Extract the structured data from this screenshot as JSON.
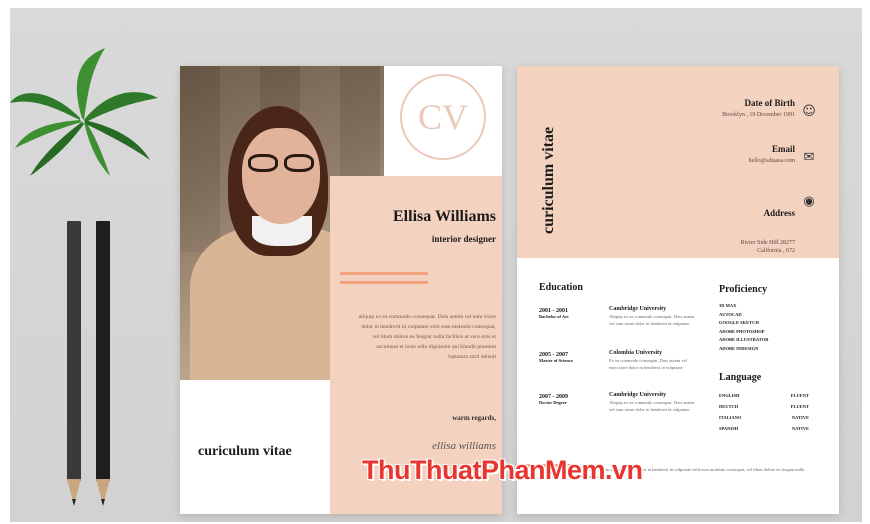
{
  "left_sheet": {
    "monogram": "CV",
    "name": "Ellisa Williams",
    "role": "interior designer",
    "intro": "aliquip ex ea commodo consequat. Duis autem vel eum iriure dolor in hendrerit in vulputate velit esse molestie consequat, vel illum dolore eu feugiat nulla facilisis at vero eros et accumsan et iusto odio dignissim qui blandit praesent luptatum zzril delenit",
    "regards": "warm regards,",
    "signature": "ellisa williams",
    "footer_title": "curiculum vitae"
  },
  "right_sheet": {
    "vertical_title": "curiculum vitae",
    "contact": [
      {
        "label": "Date of Birth",
        "value": "Brooklyn , 19 December 1991",
        "icon": "person-icon"
      },
      {
        "label": "Email",
        "value": "hello@sdiassa.com",
        "icon": "envelope-icon"
      },
      {
        "label": "Address",
        "value": "Rivier Side Hill 28277\nCalifornia , 672",
        "icon": "location-pin-icon"
      }
    ],
    "education_title": "Education",
    "education": [
      {
        "years": "2001 - 2001",
        "degree": "Bachelor of Art",
        "school": "Cambridge University",
        "text": "Aliquip ex ea commodo consequat. Duis autem vel eum iriure dolor in hendrerit in vulputate"
      },
      {
        "years": "2005 - 2007",
        "degree": "Master of Science",
        "school": "Colombia University",
        "text": "Ex ea commodo consequat. Duis autem vel eum iriure dolor in hendrerit in vulputate"
      },
      {
        "years": "2007 - 2009",
        "degree": "Doctor Degree",
        "school": "Cambridge University",
        "text": "Aliquip ex ea commodo consequat. Duis autem vel eum iriure dolor in hendrerit in vulputate"
      }
    ],
    "proficiency_title": "Proficiency",
    "skills": [
      "3D MAX",
      "AUTOCAD",
      "GOOGLE SKETCH",
      "ADOBE PHOTOSHOP",
      "ADOBE ILLUSTRATOR",
      "ADOBE INDESIGN"
    ],
    "language_title": "Language",
    "languages": [
      {
        "name": "ENGLISH",
        "level": "FLUENT"
      },
      {
        "name": "DEUTCH",
        "level": "FLUENT"
      },
      {
        "name": "ITALIANO",
        "level": "NATIVE"
      },
      {
        "name": "SPANISH",
        "level": "NATIVE"
      }
    ],
    "bottom_text": "ex ea commodo consequat. Duis autem vel eum iriure dolor in hendrerit in vulputate velit esse molestie consequat, vel illum dolore eu feugiat nulla facilisis at vero eros et accumsan et"
  },
  "watermark": "ThuThuatPhanMem.vn",
  "colors": {
    "peach": "#f4d2c0",
    "accent": "#f1a47f",
    "watermark": "#e8352f"
  }
}
